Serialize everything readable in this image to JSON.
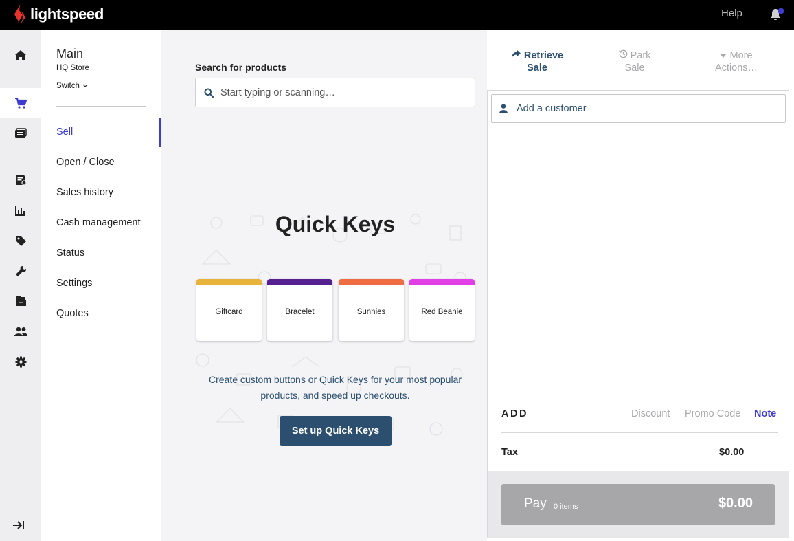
{
  "topbar": {
    "logo_text": "lightspeed",
    "help_label": "Help",
    "notification_dot_color": "#3e3cce"
  },
  "rail": {
    "items": [
      {
        "icon": "home-icon"
      },
      {
        "icon": "cart-icon",
        "active": true
      },
      {
        "icon": "register-icon"
      },
      {
        "icon": "invoice-icon"
      },
      {
        "icon": "reports-icon"
      },
      {
        "icon": "tag-icon"
      },
      {
        "icon": "wrench-icon"
      },
      {
        "icon": "inventory-icon"
      },
      {
        "icon": "customers-icon"
      },
      {
        "icon": "gear-icon"
      }
    ],
    "expand_icon": "expand-sidebar-icon"
  },
  "nav": {
    "store_title": "Main",
    "store_subtitle": "HQ Store",
    "switch_label": "Switch",
    "items": [
      {
        "label": "Sell",
        "active": true
      },
      {
        "label": "Open / Close"
      },
      {
        "label": "Sales history"
      },
      {
        "label": "Cash management"
      },
      {
        "label": "Status"
      },
      {
        "label": "Settings"
      },
      {
        "label": "Quotes"
      }
    ]
  },
  "search": {
    "label": "Search for products",
    "placeholder": "Start typing or scanning…",
    "value": ""
  },
  "quick_keys": {
    "title": "Quick Keys",
    "cards": [
      {
        "label": "Giftcard",
        "color": "#e8b33a"
      },
      {
        "label": "Bracelet",
        "color": "#55208f"
      },
      {
        "label": "Sunnies",
        "color": "#ef6c43"
      },
      {
        "label": "Red Beanie",
        "color": "#e23ee6"
      }
    ],
    "description": "Create custom buttons or Quick Keys for your most popular products, and speed up checkouts.",
    "setup_button": "Set up Quick Keys"
  },
  "actions": {
    "retrieve_line1": "Retrieve",
    "retrieve_line2": "Sale",
    "park_line1": "Park",
    "park_line2": "Sale",
    "more_line1": "More",
    "more_line2": "Actions…"
  },
  "cart": {
    "customer_label": "Add a customer",
    "add_label": "ADD",
    "discount_label": "Discount",
    "promo_label": "Promo Code",
    "note_label": "Note",
    "tax_label": "Tax",
    "tax_value": "$0.00",
    "pay_label": "Pay",
    "pay_items": "0 items",
    "pay_total": "$0.00"
  },
  "colors": {
    "accent": "#3e3cce",
    "primary_button": "#2c4f70",
    "logo_red": "#e8332a"
  }
}
